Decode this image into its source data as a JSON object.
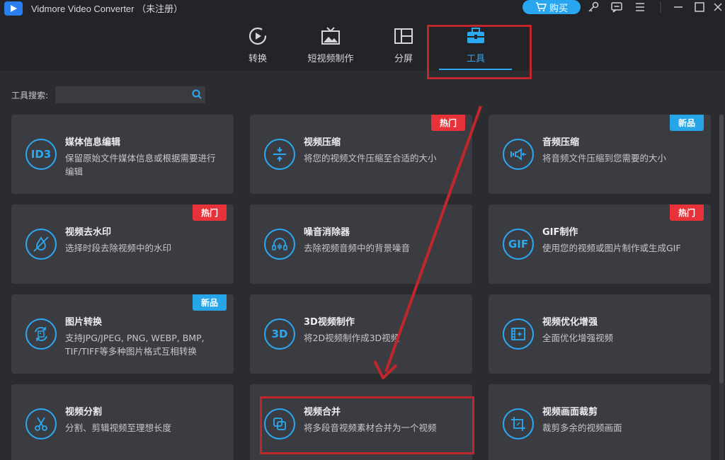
{
  "window": {
    "title": "Vidmore Video Converter （未注册）",
    "buy_label": "购买"
  },
  "nav": {
    "tabs": [
      {
        "label": "转换",
        "icon": "convert-icon"
      },
      {
        "label": "短视频制作",
        "icon": "mv-icon"
      },
      {
        "label": "分屏",
        "icon": "collage-icon"
      },
      {
        "label": "工具",
        "icon": "toolbox-icon",
        "active": true
      }
    ]
  },
  "search": {
    "label": "工具搜索:",
    "value": ""
  },
  "tools": [
    {
      "title": "媒体信息编辑",
      "desc": "保留原始文件媒体信息或根据需要进行编辑",
      "icon": "id3-icon",
      "icon_text": "ID3"
    },
    {
      "title": "视频压缩",
      "desc": "将您的视频文件压缩至合适的大小",
      "icon": "compress-icon",
      "badge": "热门"
    },
    {
      "title": "音频压缩",
      "desc": "将音频文件压缩到您需要的大小",
      "icon": "audio-compress-icon",
      "badge": "新品"
    },
    {
      "title": "视频去水印",
      "desc": "选择时段去除视频中的水印",
      "icon": "watermark-remove-icon",
      "badge": "热门"
    },
    {
      "title": "噪音消除器",
      "desc": "去除视频音频中的背景噪音",
      "icon": "noise-icon"
    },
    {
      "title": "GIF制作",
      "desc": "使用您的视频或图片制作或生成GIF",
      "icon": "gif-icon",
      "icon_text": "GIF",
      "badge": "热门"
    },
    {
      "title": "图片转换",
      "desc": "支持JPG/JPEG, PNG, WEBP, BMP, TIF/TIFF等多种图片格式互相转换",
      "icon": "image-convert-icon",
      "badge": "新品"
    },
    {
      "title": "3D视频制作",
      "desc": "将2D视频制作成3D视频",
      "icon": "3d-icon",
      "icon_text": "3D"
    },
    {
      "title": "视频优化增强",
      "desc": "全面优化增强视频",
      "icon": "enhance-icon"
    },
    {
      "title": "视频分割",
      "desc": "分割、剪辑视频至理想长度",
      "icon": "scissors-icon"
    },
    {
      "title": "视频合并",
      "desc": "将多段音视频素材合并为一个视频",
      "icon": "merge-icon"
    },
    {
      "title": "视频画面裁剪",
      "desc": "裁剪多余的视频画面",
      "icon": "crop-icon"
    }
  ],
  "colors": {
    "accent": "#2ba9f2",
    "hot_badge": "#e8323a",
    "new_badge": "#26a6e8",
    "annotation": "#c0272d"
  }
}
